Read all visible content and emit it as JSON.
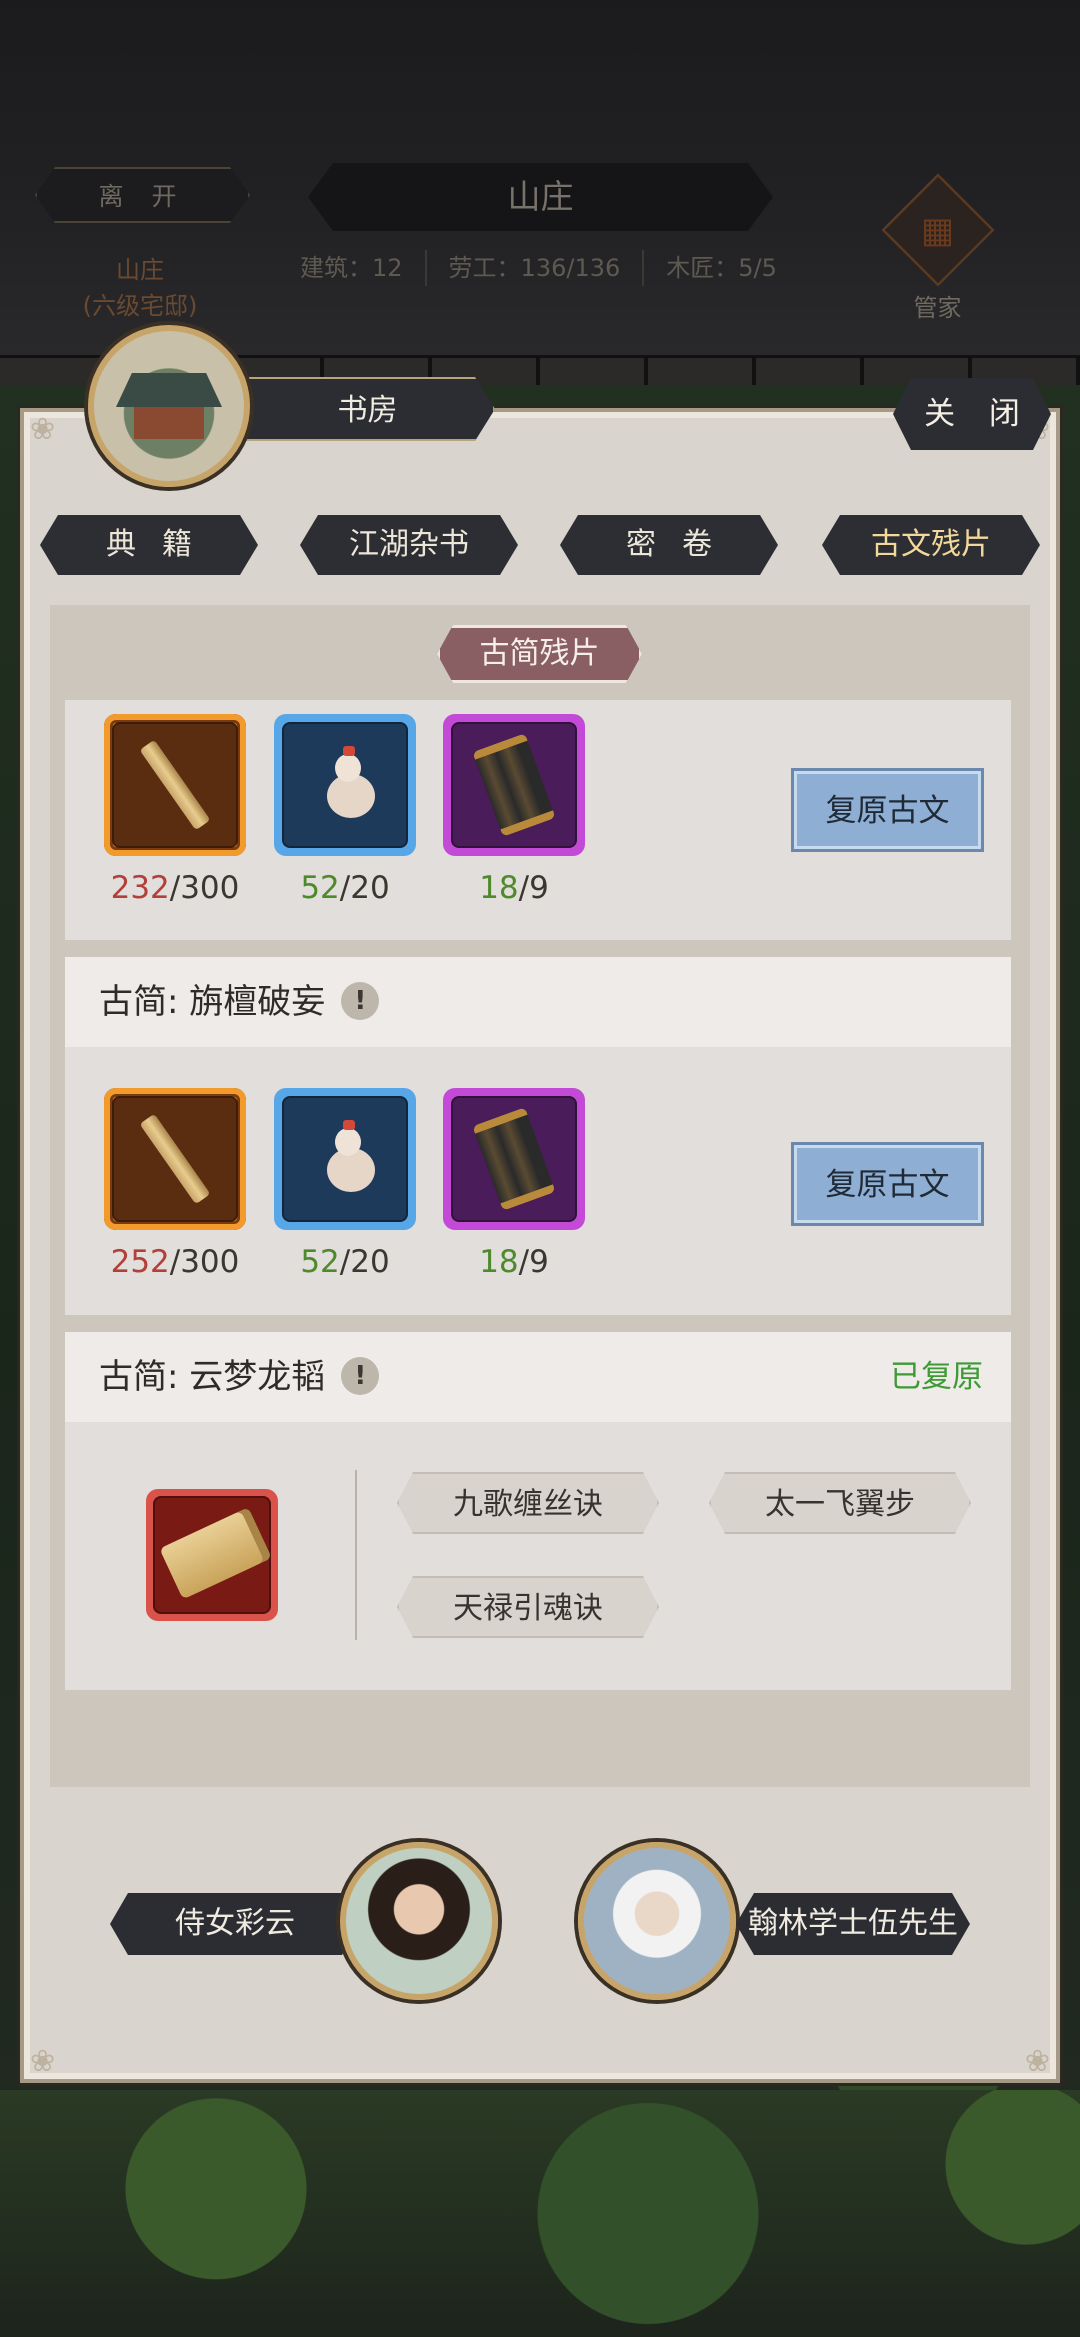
{
  "top": {
    "leave_label": "离 开",
    "estate_title": "山庄",
    "estate_name": "山庄",
    "estate_level": "(六级宅邸)",
    "stats": [
      "建筑：12",
      "劳工：136/136",
      "木匠：5/5"
    ],
    "steward_label": "管家"
  },
  "panel": {
    "room_name": "书房",
    "close_label": "关 闭",
    "tabs": [
      {
        "label": "典籍"
      },
      {
        "label": "江湖杂书"
      },
      {
        "label": "密卷"
      },
      {
        "label": "古文残片"
      }
    ],
    "section_title": "古简残片",
    "cards": [
      {
        "materials": [
          {
            "icon": "bamboo-slip-icon",
            "have": "232",
            "need": "/300"
          },
          {
            "icon": "gourd-icon",
            "have": "52",
            "need": "/20"
          },
          {
            "icon": "scroll-icon",
            "have": "18",
            "need": "/9"
          }
        ],
        "button": "复原古文"
      },
      {
        "title": "古简: 旃檀破妄",
        "materials": [
          {
            "icon": "bamboo-slip-icon",
            "have": "252",
            "need": "/300"
          },
          {
            "icon": "gourd-icon",
            "have": "52",
            "need": "/20"
          },
          {
            "icon": "scroll-icon",
            "have": "18",
            "need": "/9"
          }
        ],
        "button": "复原古文"
      },
      {
        "title": "古简: 云梦龙韬",
        "status": "已复原",
        "skills": [
          "九歌缠丝诀",
          "太一飞翼步",
          "天禄引魂诀"
        ]
      }
    ]
  },
  "npcs": [
    {
      "name": "侍女彩云"
    },
    {
      "name": "翰林学士伍先生"
    }
  ],
  "colors": {
    "insufficient": "#b2403a",
    "sufficient": "#4e8a2c",
    "restored": "#3d9a35",
    "active_tab_text": "#f2d89a"
  }
}
